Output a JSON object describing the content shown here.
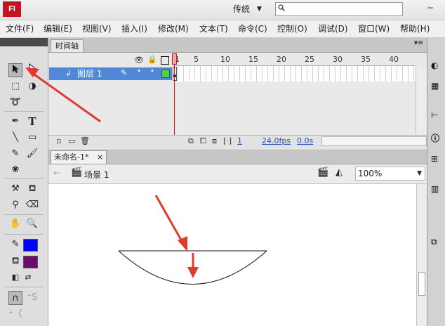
{
  "app": {
    "logo": "Fl",
    "workspace": "传统",
    "search_placeholder": ""
  },
  "menu": [
    "文件(F)",
    "编辑(E)",
    "视图(V)",
    "插入(I)",
    "修改(M)",
    "文本(T)",
    "命令(C)",
    "控制(O)",
    "调试(D)",
    "窗口(W)",
    "帮助(H)"
  ],
  "timeline": {
    "tab": "时间轴",
    "ruler": [
      "5",
      "10",
      "15",
      "20",
      "25",
      "30",
      "35",
      "40"
    ],
    "first_frame": "1",
    "layer_name": "图层 1",
    "current_frame": "1",
    "fps": "24.0fps",
    "time": "0.0s"
  },
  "document": {
    "tab_title": "未命名-1*",
    "close": "×",
    "scene": "场景 1",
    "zoom": "100%"
  },
  "colors": {
    "stroke": "#0000ff",
    "fill": "#6b0b6b",
    "layer_highlight": "#4f89d8",
    "arrow": "#e03a2c"
  }
}
